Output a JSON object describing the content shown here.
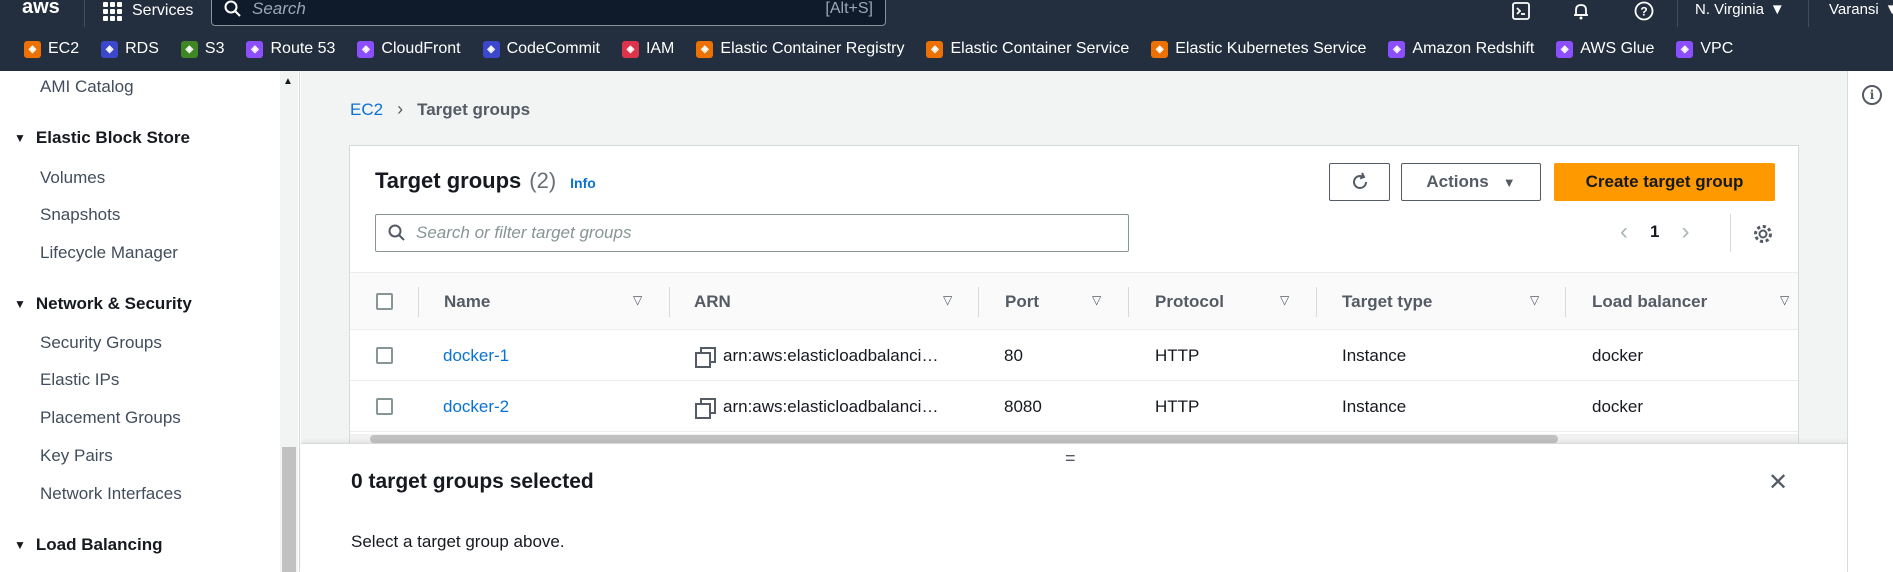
{
  "topnav": {
    "logo": "aws",
    "services_label": "Services",
    "search_placeholder": "Search",
    "search_shortcut": "[Alt+S]",
    "region": "N. Virginia",
    "account": "Varansi"
  },
  "favorites": [
    {
      "label": "EC2",
      "color": "#ed7100"
    },
    {
      "label": "RDS",
      "color": "#3b48cc"
    },
    {
      "label": "S3",
      "color": "#3f8624"
    },
    {
      "label": "Route 53",
      "color": "#8c4fff"
    },
    {
      "label": "CloudFront",
      "color": "#8c4fff"
    },
    {
      "label": "CodeCommit",
      "color": "#3b48cc"
    },
    {
      "label": "IAM",
      "color": "#dd344c"
    },
    {
      "label": "Elastic Container Registry",
      "color": "#ed7100"
    },
    {
      "label": "Elastic Container Service",
      "color": "#ed7100"
    },
    {
      "label": "Elastic Kubernetes Service",
      "color": "#ed7100"
    },
    {
      "label": "Amazon Redshift",
      "color": "#8c4fff"
    },
    {
      "label": "AWS Glue",
      "color": "#8c4fff"
    },
    {
      "label": "VPC",
      "color": "#8c4fff"
    }
  ],
  "sidebar": {
    "ami_catalog": "AMI Catalog",
    "ebs_head": "Elastic Block Store",
    "volumes": "Volumes",
    "snapshots": "Snapshots",
    "lifecycle": "Lifecycle Manager",
    "netsec_head": "Network & Security",
    "security_groups": "Security Groups",
    "elastic_ips": "Elastic IPs",
    "placement_groups": "Placement Groups",
    "key_pairs": "Key Pairs",
    "network_interfaces": "Network Interfaces",
    "lb_head": "Load Balancing"
  },
  "breadcrumb": {
    "parent": "EC2",
    "current": "Target groups"
  },
  "card": {
    "title": "Target groups",
    "count": "(2)",
    "info": "Info",
    "actions_label": "Actions",
    "create_label": "Create target group",
    "filter_placeholder": "Search or filter target groups",
    "page": "1"
  },
  "table": {
    "headers": [
      "Name",
      "ARN",
      "Port",
      "Protocol",
      "Target type",
      "Load balancer"
    ],
    "rows": [
      {
        "name": "docker-1",
        "arn": "arn:aws:elasticloadbalanci…",
        "port": "80",
        "protocol": "HTTP",
        "target_type": "Instance",
        "lb": "docker"
      },
      {
        "name": "docker-2",
        "arn": "arn:aws:elasticloadbalanci…",
        "port": "8080",
        "protocol": "HTTP",
        "target_type": "Instance",
        "lb": "docker"
      }
    ]
  },
  "split": {
    "handle": "=",
    "title": "0 target groups selected",
    "message": "Select a target group above."
  }
}
